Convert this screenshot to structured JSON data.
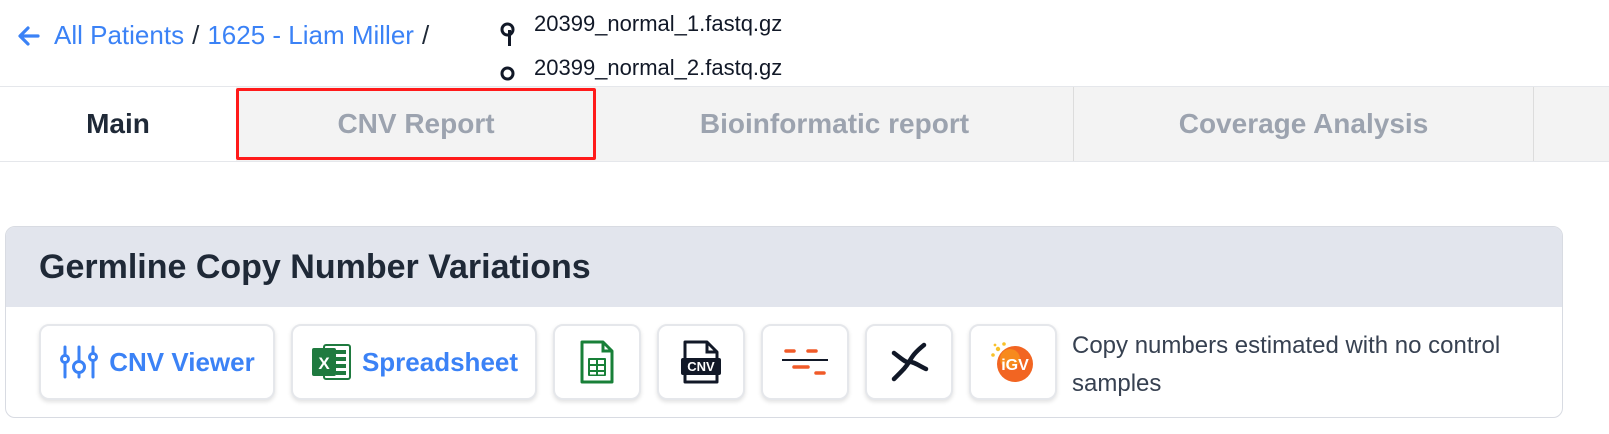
{
  "breadcrumb": {
    "all_patients": "All Patients",
    "separator": "/",
    "patient": "1625 - Liam Miller",
    "files": [
      "20399_normal_1.fastq.gz",
      "20399_normal_2.fastq.gz"
    ]
  },
  "tabs": [
    {
      "label": "Main",
      "active": true
    },
    {
      "label": "CNV Report",
      "active": false,
      "highlighted": true
    },
    {
      "label": "Bioinformatic report",
      "active": false
    },
    {
      "label": "Coverage Analysis",
      "active": false
    }
  ],
  "card": {
    "title": "Germline Copy Number Variations",
    "buttons": [
      {
        "label": "CNV Viewer",
        "icon": "cnv-viewer-icon"
      },
      {
        "label": "Spreadsheet",
        "icon": "excel-icon"
      },
      {
        "label": "",
        "icon": "google-sheets-icon"
      },
      {
        "label": "",
        "icon": "cnv-file-icon"
      },
      {
        "label": "",
        "icon": "segments-icon"
      },
      {
        "label": "",
        "icon": "chromosome-icon"
      },
      {
        "label": "",
        "icon": "igv-icon"
      }
    ],
    "note": "Copy numbers estimated with no control samples"
  },
  "colors": {
    "link": "#3b82f6",
    "highlight_border": "#ff1a1a",
    "card_header_bg": "#e2e5ed",
    "excel_green": "#1f7a3f",
    "sheets_green": "#188038",
    "segments_orange": "#f05a28",
    "igv_orange": "#f26522"
  }
}
